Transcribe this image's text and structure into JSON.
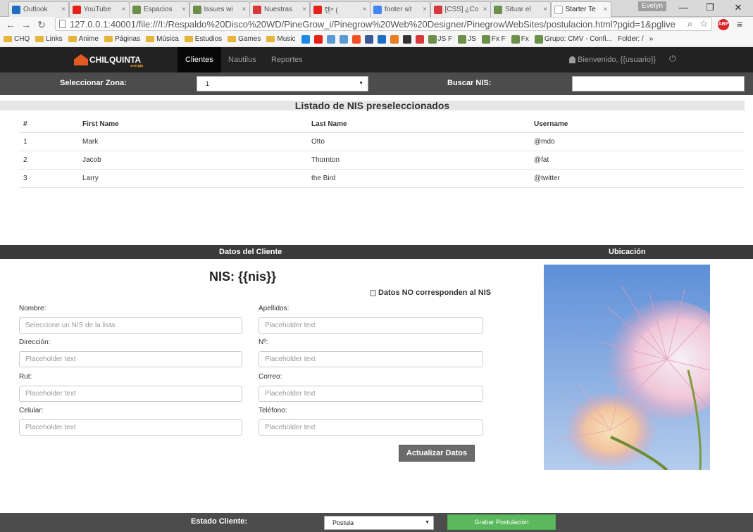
{
  "browser": {
    "tabs": [
      {
        "label": "Outlook",
        "color": "#1e6fc2"
      },
      {
        "label": "YouTube",
        "color": "#e62117"
      },
      {
        "label": "Espacios",
        "color": "#6c8f4a"
      },
      {
        "label": "Issues wi",
        "color": "#6c8f4a"
      },
      {
        "label": "Nuestras",
        "color": "#d9383a"
      },
      {
        "label": "텐* (",
        "color": "#e62117"
      },
      {
        "label": "footer sit",
        "color": "#4285f4"
      },
      {
        "label": "[CSS] ¿Co",
        "color": "#d9383a"
      },
      {
        "label": "Situar el",
        "color": "#6c8f4a"
      },
      {
        "label": "Starter Te",
        "color": "#ffffff"
      }
    ],
    "user_chip": "Evelyn",
    "url": "127.0.0.1:40001/file:///I:/Respaldo%20Disco%20WD/PineGrow_i/Pinegrow%20Web%20Designer/PinegrowWebSites/postulacion.html?pgid=1&pglive",
    "bookmarks": [
      {
        "label": "CHQ",
        "type": "folder"
      },
      {
        "label": "Links",
        "type": "folder"
      },
      {
        "label": "Anime",
        "type": "folder"
      },
      {
        "label": "Páginas",
        "type": "folder"
      },
      {
        "label": "Música",
        "type": "folder"
      },
      {
        "label": "Estudios",
        "type": "folder"
      },
      {
        "label": "Games",
        "type": "folder"
      },
      {
        "label": "Music",
        "type": "folder"
      }
    ],
    "bookmark_icons": [
      "#1e88e5",
      "#e62117",
      "#5b9bd5",
      "#5b9bd5",
      "#f25022",
      "#3b5998",
      "#1e6fc2",
      "#e67e22",
      "#333333",
      "#d9383a"
    ],
    "bookmark_labeled_icons": [
      {
        "label": "JS F",
        "color": "#6c8f4a"
      },
      {
        "label": "JS",
        "color": "#6c8f4a"
      },
      {
        "label": "Fx F",
        "color": "#6c8f4a"
      },
      {
        "label": "Fx",
        "color": "#6c8f4a"
      },
      {
        "label": "Grupo: CMV - Confi...",
        "color": "#6c8f4a"
      }
    ],
    "bookmark_trailing": "Folder: /",
    "bookmark_more": "»"
  },
  "app": {
    "brand": "CHILQUINTA",
    "brand_sub": "energía",
    "nav": {
      "clientes": "Clientes",
      "nautilus": "Nautilus",
      "reportes": "Reportes"
    },
    "welcome": "Bienvenido, {{usuario}}"
  },
  "filter": {
    "zone_label": "Seleccionar Zona:",
    "zone_value": "1",
    "search_label": "Buscar NIS:"
  },
  "list": {
    "title": "Listado de NIS preseleccionados",
    "headers": [
      "#",
      "First Name",
      "Last Name",
      "Username"
    ],
    "rows": [
      [
        "1",
        "Mark",
        "Otto",
        "@mdo"
      ],
      [
        "2",
        "Jacob",
        "Thornton",
        "@fat"
      ],
      [
        "3",
        "Larry",
        "the Bird",
        "@twitter"
      ]
    ]
  },
  "client": {
    "section_title": "Datos del Cliente",
    "location_title": "Ubicación",
    "nis_title": "NIS: {{nis}}",
    "mismatch_label": "Datos NO corresponden al NIS",
    "fields": {
      "nombre": {
        "label": "Nombre:",
        "placeholder": "Seleccione un NIS de la lista"
      },
      "apellidos": {
        "label": "Apellidos:",
        "placeholder": "Placeholder text"
      },
      "direccion": {
        "label": "Dirección:",
        "placeholder": "Placeholder text"
      },
      "numero": {
        "label": "Nº:",
        "placeholder": "Placeholder text"
      },
      "rut": {
        "label": "Rut:",
        "placeholder": "Placeholder text"
      },
      "correo": {
        "label": "Correo:",
        "placeholder": "Placeholder text"
      },
      "celular": {
        "label": "Celular:",
        "placeholder": "Placeholder text"
      },
      "telefono": {
        "label": "Teléfono:",
        "placeholder": "Placeholder text"
      }
    },
    "update_button": "Actualizar Datos"
  },
  "footer": {
    "estado_label": "Estado Cliente:",
    "estado_value": "Postula",
    "save_button": "Grabar Postulación"
  }
}
